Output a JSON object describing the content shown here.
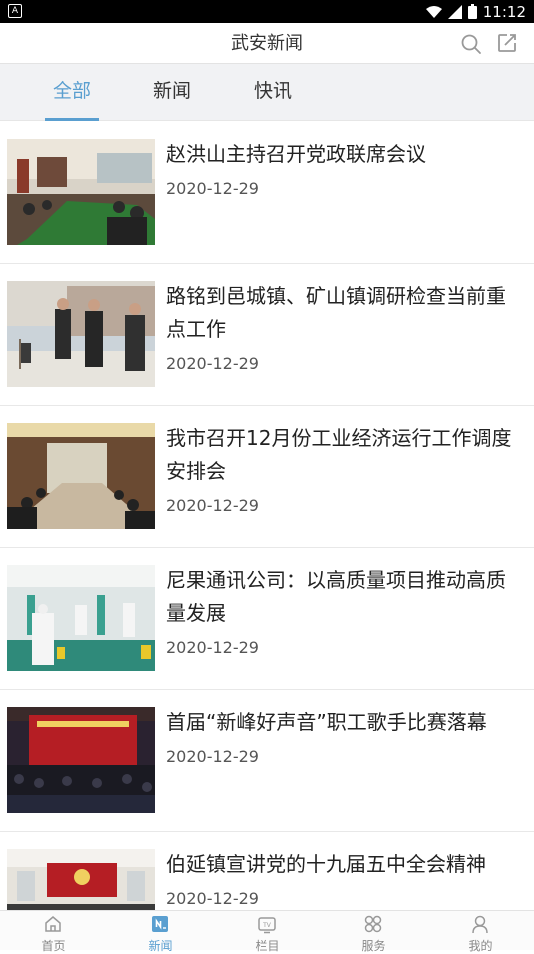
{
  "status_bar": {
    "time": "11:12"
  },
  "app_bar": {
    "title": "武安新闻",
    "search_icon": "search-icon",
    "share_icon": "share-icon"
  },
  "tabs": [
    {
      "label": "全部",
      "active": true
    },
    {
      "label": "新闻",
      "active": false
    },
    {
      "label": "快讯",
      "active": false
    }
  ],
  "news": [
    {
      "title": "赵洪山主持召开党政联席会议",
      "date": "2020-12-29"
    },
    {
      "title": "路铭到邑城镇、矿山镇调研检查当前重点工作",
      "date": "2020-12-29"
    },
    {
      "title": "我市召开12月份工业经济运行工作调度安排会",
      "date": "2020-12-29"
    },
    {
      "title": "尼果通讯公司：以高质量项目推动高质量发展",
      "date": "2020-12-29"
    },
    {
      "title": "首届“新峰好声音”职工歌手比赛落幕",
      "date": "2020-12-29"
    },
    {
      "title": "伯延镇宣讲党的十九届五中全会精神",
      "date": "2020-12-29"
    }
  ],
  "bottom_nav": [
    {
      "label": "首页",
      "icon": "home-icon",
      "active": false
    },
    {
      "label": "新闻",
      "icon": "news-icon",
      "active": true
    },
    {
      "label": "栏目",
      "icon": "tv-icon",
      "active": false
    },
    {
      "label": "服务",
      "icon": "services-icon",
      "active": false
    },
    {
      "label": "我的",
      "icon": "profile-icon",
      "active": false
    }
  ],
  "colors": {
    "accent": "#5a9fd0",
    "tab_bar_bg": "#f1f2f4",
    "text": "#222222"
  }
}
